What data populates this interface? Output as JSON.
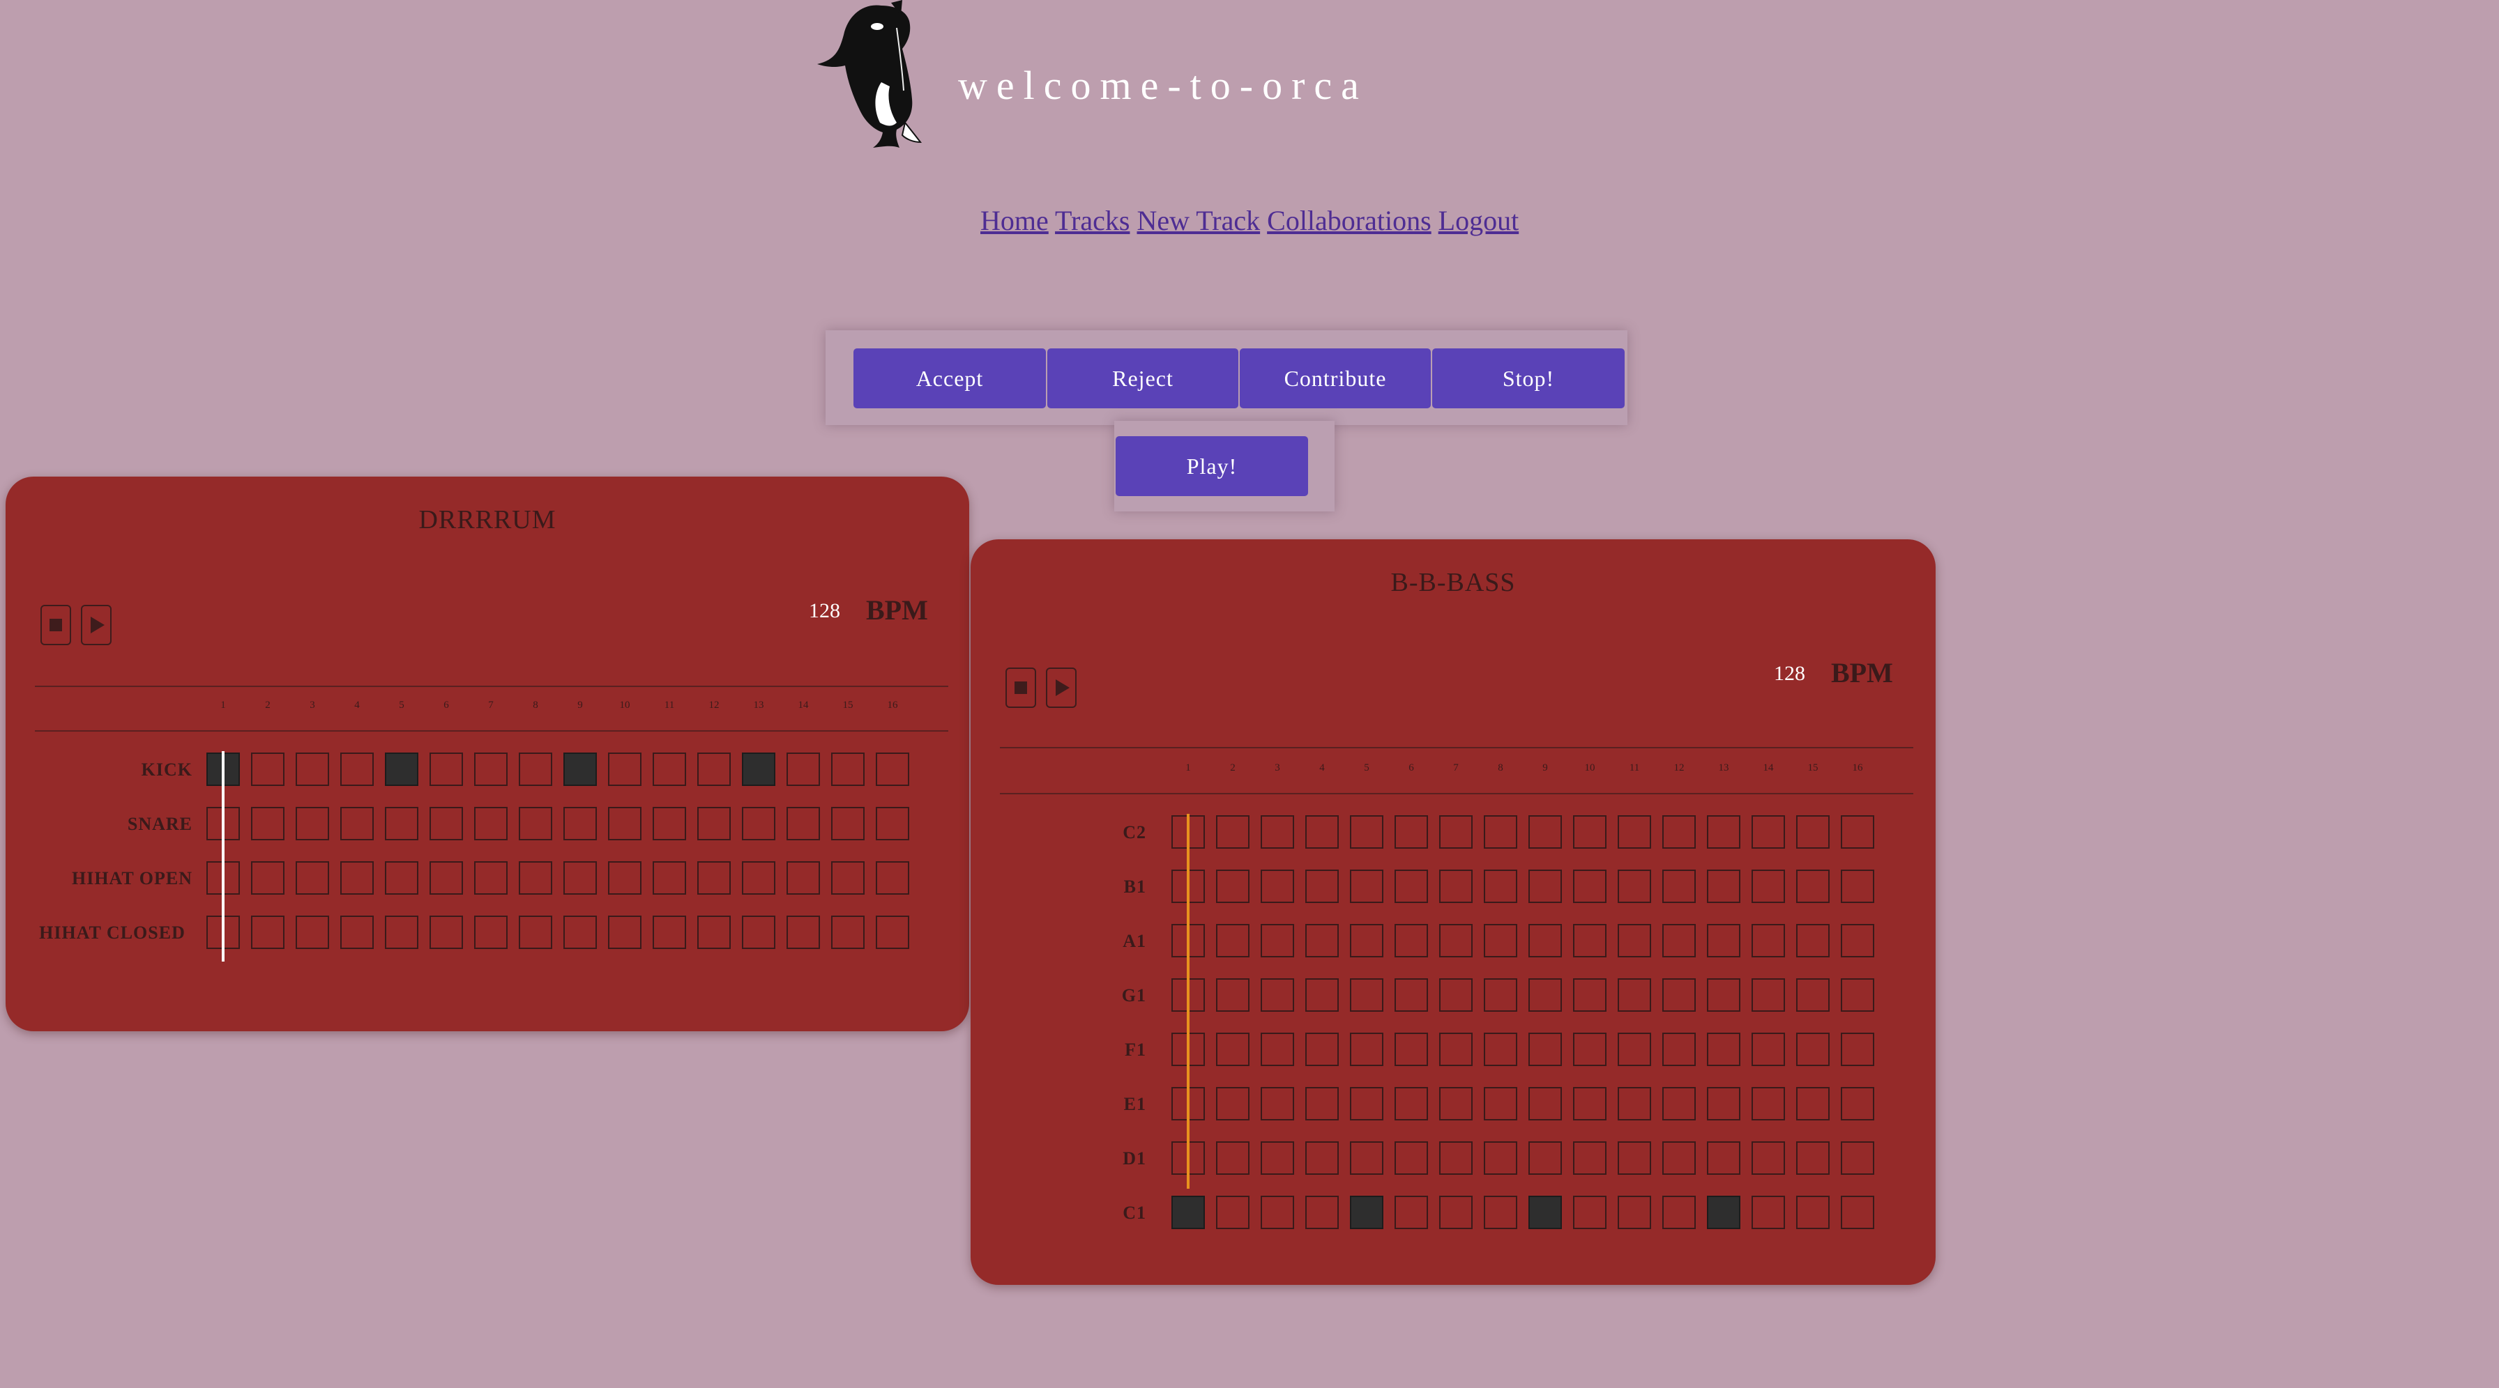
{
  "site_title": "welcome-to-orca",
  "nav": [
    {
      "label": "Home"
    },
    {
      "label": "Tracks"
    },
    {
      "label": "New Track"
    },
    {
      "label": "Collaborations"
    },
    {
      "label": "Logout"
    }
  ],
  "actions": {
    "accept": "Accept",
    "reject": "Reject",
    "contribute": "Contribute",
    "stop": "Stop!",
    "play": "Play!"
  },
  "drum_track": {
    "title": "DRRRRUM",
    "bpm": "128",
    "bpm_label": "BPM",
    "steps": [
      "1",
      "2",
      "3",
      "4",
      "5",
      "6",
      "7",
      "8",
      "9",
      "10",
      "11",
      "12",
      "13",
      "14",
      "15",
      "16"
    ],
    "rows": [
      {
        "label": "KICK",
        "active_steps": [
          1,
          5,
          9,
          13
        ]
      },
      {
        "label": "SNARE",
        "active_steps": []
      },
      {
        "label": "HIHAT OPEN",
        "active_steps": []
      },
      {
        "label": "HIHAT CLOSED",
        "active_steps": []
      }
    ],
    "playhead_step": 1,
    "playhead_color": "#ffffff"
  },
  "bass_track": {
    "title": "B-B-BASS",
    "bpm": "128",
    "bpm_label": "BPM",
    "steps": [
      "1",
      "2",
      "3",
      "4",
      "5",
      "6",
      "7",
      "8",
      "9",
      "10",
      "11",
      "12",
      "13",
      "14",
      "15",
      "16"
    ],
    "rows": [
      {
        "label": "C2",
        "active_steps": []
      },
      {
        "label": "B1",
        "active_steps": []
      },
      {
        "label": "A1",
        "active_steps": []
      },
      {
        "label": "G1",
        "active_steps": []
      },
      {
        "label": "F1",
        "active_steps": []
      },
      {
        "label": "E1",
        "active_steps": []
      },
      {
        "label": "D1",
        "active_steps": []
      },
      {
        "label": "C1",
        "active_steps": [
          1,
          5,
          9,
          13
        ]
      }
    ],
    "playhead_step": 1,
    "playhead_color": "#e8921e"
  },
  "colors": {
    "background": "#bd9eae",
    "card": "#952a29",
    "button": "#5a42b7",
    "link": "#4e2d93"
  }
}
